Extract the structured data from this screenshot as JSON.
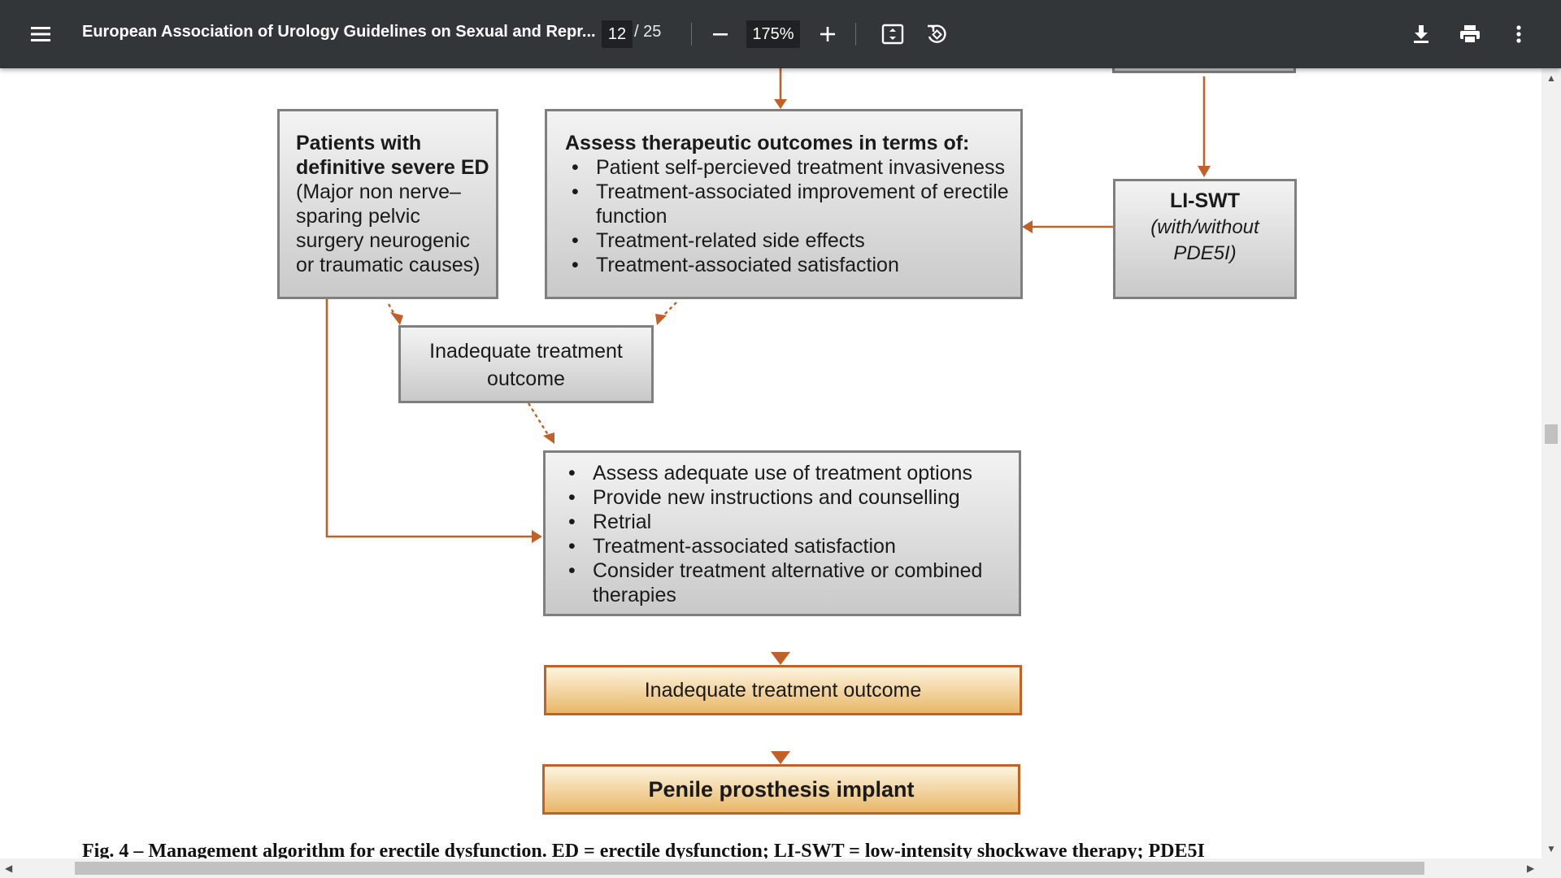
{
  "toolbar": {
    "title": "European Association of Urology Guidelines on Sexual and Repr...",
    "current_page": "12",
    "page_total": "/  25",
    "zoom": "175%",
    "icons": [
      "menu-icon",
      "minus-icon",
      "plus-icon",
      "fit-page-icon",
      "rotate-icon",
      "download-icon",
      "print-icon",
      "more-vert-icon"
    ]
  },
  "flowchart": {
    "severe_ed": {
      "title_line1": "Patients with",
      "title_line2": "definitive severe ED",
      "lines": [
        "(Major non nerve–",
        "sparing pelvic",
        "surgery neurogenic",
        "or traumatic causes)"
      ]
    },
    "assess_outcomes": {
      "title": "Assess therapeutic outcomes in terms of:",
      "items": [
        "Patient self-percieved treatment invasiveness",
        "Treatment-associated improvement of erectile function",
        "Treatment-related side effects",
        "Treatment-associated satisfaction"
      ]
    },
    "li_swt": {
      "title": "LI-SWT",
      "subtitle_line1": "(with/without",
      "subtitle_line2": "PDE5I)"
    },
    "inadequate_1": {
      "line1": "Inadequate treatment",
      "line2": "outcome"
    },
    "reassess": {
      "items": [
        "Assess adequate use of treatment options",
        "Provide new instructions and counselling",
        "Retrial",
        "Treatment-associated satisfaction",
        "Consider treatment alternative or combined therapies"
      ]
    },
    "inadequate_2": "Inadequate treatment outcome",
    "prosthesis": "Penile prosthesis implant",
    "caption": "Fig. 4 – Management algorithm for erectile dysfunction. ED = erectile dysfunction; LI-SWT = low-intensity shockwave therapy; PDE5I"
  },
  "colors": {
    "toolbar_bg": "#323639",
    "arrow": "#c0612a",
    "box_border": "#7f7f7f",
    "highlight_border": "#c0612a"
  }
}
